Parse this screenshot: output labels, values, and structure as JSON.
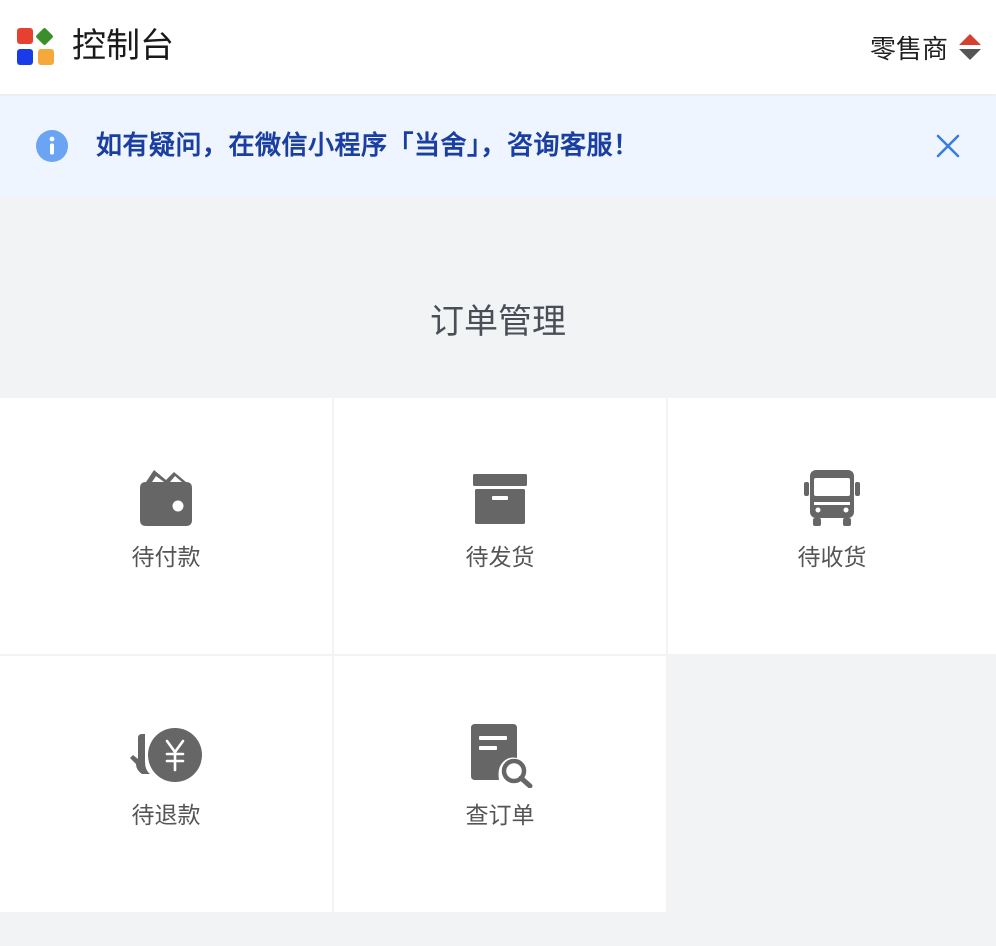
{
  "header": {
    "title": "控制台",
    "logo_colors": [
      "#e8402f",
      "#3b8f2a",
      "#1a3be8",
      "#f5a93a"
    ],
    "logo_icon": "app-grid-logo-icon",
    "role_label": "零售商",
    "role_switch_icon": "sort-up-down-icon",
    "role_switch_colors": {
      "up": "#d5402f",
      "down": "#555555"
    }
  },
  "notice": {
    "text": "如有疑问，在微信小程序「当舍」，咨询客服！",
    "icon": "info-icon",
    "close_icon": "close-icon",
    "colors": {
      "background": "#eef5fe",
      "text": "#1a3fa0",
      "icon": "#6aa4f2"
    }
  },
  "order_management": {
    "title": "订单管理",
    "items": [
      {
        "label": "待付款",
        "icon": "wallet-icon"
      },
      {
        "label": "待发货",
        "icon": "archive-box-icon"
      },
      {
        "label": "待收货",
        "icon": "truck-icon"
      },
      {
        "label": "待退款",
        "icon": "refund-yen-icon"
      },
      {
        "label": "查订单",
        "icon": "order-search-icon"
      }
    ]
  }
}
